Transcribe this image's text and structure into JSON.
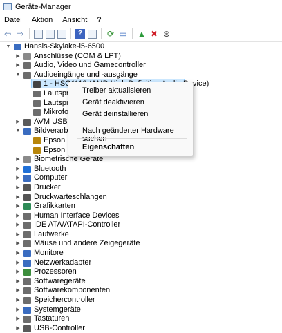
{
  "window": {
    "title": "Geräte-Manager"
  },
  "menubar": [
    "Datei",
    "Aktion",
    "Ansicht",
    "?"
  ],
  "toolbar": [
    {
      "name": "back-icon",
      "glyph": "⇦",
      "color": "#4a6fa8"
    },
    {
      "name": "forward-icon",
      "glyph": "⇨",
      "color": "#4a6fa8"
    },
    {
      "sep": true
    },
    {
      "name": "properties-icon",
      "glyph": "",
      "box": true
    },
    {
      "name": "list-view-icon",
      "glyph": "",
      "box": true
    },
    {
      "name": "details-view-icon",
      "glyph": "",
      "box": true
    },
    {
      "sep": true
    },
    {
      "name": "help-icon",
      "glyph": "?",
      "help": true
    },
    {
      "name": "device-view-icon",
      "glyph": "",
      "box": true
    },
    {
      "sep": true
    },
    {
      "name": "scan-hardware-icon",
      "glyph": "⟳",
      "color": "#2f8f2f"
    },
    {
      "name": "monitor-icon",
      "glyph": "▭",
      "color": "#3a6cc0"
    },
    {
      "sep": true
    },
    {
      "name": "add-driver-icon",
      "glyph": "▲",
      "color": "#2b9a3a"
    },
    {
      "name": "uninstall-icon",
      "glyph": "✖",
      "color": "#d0202a"
    },
    {
      "name": "update-driver-icon",
      "glyph": "⊛",
      "color": "#333333"
    }
  ],
  "tree": [
    {
      "label": "Hansis-Skylake-i5-6500",
      "level": 0,
      "state": "open",
      "icon": "computer-icon",
      "color": "#3a6cc0"
    },
    {
      "label": "Anschlüsse (COM & LPT)",
      "level": 1,
      "state": "closed",
      "icon": "port-icon",
      "color": "#8a8a8a"
    },
    {
      "label": "Audio, Video und Gamecontroller",
      "level": 1,
      "state": "closed",
      "icon": "speaker-icon",
      "color": "#6d6d6d"
    },
    {
      "label": "Audioeingänge und -ausgänge",
      "level": 1,
      "state": "open",
      "icon": "speaker-icon",
      "color": "#6d6d6d"
    },
    {
      "label": "1 - HSG1113 (AMD High Definition Audio Device)",
      "level": 2,
      "state": "leaf",
      "icon": "monitor-icon",
      "color": "#444444",
      "selected": true
    },
    {
      "label": "Lautsprecher",
      "level": 2,
      "state": "leaf",
      "icon": "speaker-icon",
      "color": "#6d6d6d"
    },
    {
      "label": "Lautsprecher",
      "level": 2,
      "state": "leaf",
      "icon": "speaker-icon",
      "color": "#6d6d6d"
    },
    {
      "label": "Mikrofon",
      "level": 2,
      "state": "leaf",
      "icon": "microphone-icon",
      "color": "#6d6d6d"
    },
    {
      "label": "AVM USB-Geräte",
      "level": 1,
      "state": "closed",
      "icon": "usb-icon",
      "color": "#5a5a5a"
    },
    {
      "label": "Bildverarbeitungsgeräte",
      "level": 1,
      "state": "open",
      "icon": "camera-icon",
      "color": "#3a6cc0"
    },
    {
      "label": "Epson",
      "level": 2,
      "state": "leaf",
      "icon": "scanner-warning-icon",
      "color": "#b8860b"
    },
    {
      "label": "Epson",
      "level": 2,
      "state": "leaf",
      "icon": "scanner-warning-icon",
      "color": "#b8860b"
    },
    {
      "label": "Biometrische Geräte",
      "level": 1,
      "state": "closed",
      "icon": "fingerprint-icon",
      "color": "#8a8a8a"
    },
    {
      "label": "Bluetooth",
      "level": 1,
      "state": "closed",
      "icon": "bluetooth-icon",
      "color": "#1f6fd6"
    },
    {
      "label": "Computer",
      "level": 1,
      "state": "closed",
      "icon": "computer-icon",
      "color": "#3a6cc0"
    },
    {
      "label": "Drucker",
      "level": 1,
      "state": "closed",
      "icon": "printer-icon",
      "color": "#555555"
    },
    {
      "label": "Druckwarteschlangen",
      "level": 1,
      "state": "closed",
      "icon": "printer-queue-icon",
      "color": "#555555"
    },
    {
      "label": "Grafikkarten",
      "level": 1,
      "state": "closed",
      "icon": "display-adapter-icon",
      "color": "#2e8b57"
    },
    {
      "label": "Human Interface Devices",
      "level": 1,
      "state": "closed",
      "icon": "hid-icon",
      "color": "#6d6d6d"
    },
    {
      "label": "IDE ATA/ATAPI-Controller",
      "level": 1,
      "state": "closed",
      "icon": "ide-controller-icon",
      "color": "#6d6d6d"
    },
    {
      "label": "Laufwerke",
      "level": 1,
      "state": "closed",
      "icon": "disk-drive-icon",
      "color": "#6d6d6d"
    },
    {
      "label": "Mäuse und andere Zeigegeräte",
      "level": 1,
      "state": "closed",
      "icon": "mouse-icon",
      "color": "#6d6d6d"
    },
    {
      "label": "Monitore",
      "level": 1,
      "state": "closed",
      "icon": "monitor-icon",
      "color": "#3a6cc0"
    },
    {
      "label": "Netzwerkadapter",
      "level": 1,
      "state": "closed",
      "icon": "network-adapter-icon",
      "color": "#3a6cc0"
    },
    {
      "label": "Prozessoren",
      "level": 1,
      "state": "closed",
      "icon": "processor-icon",
      "color": "#3c8d3c"
    },
    {
      "label": "Softwaregeräte",
      "level": 1,
      "state": "closed",
      "icon": "software-device-icon",
      "color": "#6d6d6d"
    },
    {
      "label": "Softwarekomponenten",
      "level": 1,
      "state": "closed",
      "icon": "software-component-icon",
      "color": "#6d6d6d"
    },
    {
      "label": "Speichercontroller",
      "level": 1,
      "state": "closed",
      "icon": "storage-controller-icon",
      "color": "#6d6d6d"
    },
    {
      "label": "Systemgeräte",
      "level": 1,
      "state": "closed",
      "icon": "system-device-icon",
      "color": "#3a6cc0"
    },
    {
      "label": "Tastaturen",
      "level": 1,
      "state": "closed",
      "icon": "keyboard-icon",
      "color": "#6d6d6d"
    },
    {
      "label": "USB-Controller",
      "level": 1,
      "state": "closed",
      "icon": "usb-icon",
      "color": "#5a5a5a"
    }
  ],
  "context_menu": {
    "items": [
      {
        "label": "Treiber aktualisieren",
        "bold": false
      },
      {
        "label": "Gerät deaktivieren",
        "bold": false
      },
      {
        "label": "Gerät deinstallieren",
        "bold": false
      },
      {
        "sep": true
      },
      {
        "label": "Nach geänderter Hardware suchen",
        "bold": false
      },
      {
        "sep": true
      },
      {
        "label": "Eigenschaften",
        "bold": true
      }
    ]
  }
}
